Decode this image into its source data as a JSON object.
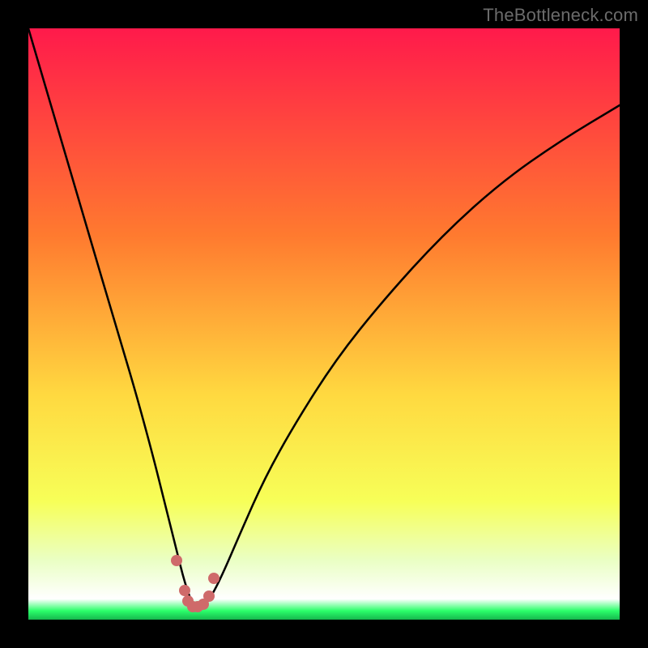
{
  "watermark": {
    "text": "TheBottleneck.com"
  },
  "colors": {
    "top": "#ff1a4b",
    "upper_mid": "#ff7a2f",
    "mid": "#ffd940",
    "lower_mid": "#f7ff58",
    "pale": "#eaffc4",
    "green": "#2bff6a",
    "curve": "#000000",
    "marker": "#cf6a6a",
    "frame": "#000000"
  },
  "chart_data": {
    "type": "line",
    "title": "",
    "xlabel": "",
    "ylabel": "",
    "xlim": [
      0,
      100
    ],
    "ylim": [
      0,
      100
    ],
    "series": [
      {
        "name": "bottleneck-curve",
        "x": [
          0,
          5,
          10,
          15,
          18,
          21,
          23,
          25,
          26.5,
          28,
          29.5,
          31,
          33,
          36,
          40,
          45,
          52,
          60,
          70,
          80,
          90,
          100
        ],
        "y": [
          100,
          83,
          66,
          49,
          39,
          28,
          20,
          12,
          6,
          2,
          2,
          4,
          8,
          15,
          24,
          33,
          44,
          54,
          65,
          74,
          81,
          87
        ]
      }
    ],
    "markers": {
      "name": "highlighted-points",
      "x": [
        25.0,
        26.4,
        27.0,
        27.8,
        28.6,
        29.6,
        30.6,
        31.4
      ],
      "y": [
        10.0,
        5.0,
        3.2,
        2.2,
        2.2,
        2.6,
        4.0,
        7.0
      ]
    },
    "gradient_stops": [
      {
        "pos": 0.0,
        "color": "#ff1a4b"
      },
      {
        "pos": 0.35,
        "color": "#ff7a2f"
      },
      {
        "pos": 0.62,
        "color": "#ffd940"
      },
      {
        "pos": 0.8,
        "color": "#f7ff58"
      },
      {
        "pos": 0.9,
        "color": "#eaffc4"
      },
      {
        "pos": 0.965,
        "color": "#ffffff"
      },
      {
        "pos": 0.985,
        "color": "#2bff6a"
      },
      {
        "pos": 1.0,
        "color": "#16b84e"
      }
    ]
  }
}
